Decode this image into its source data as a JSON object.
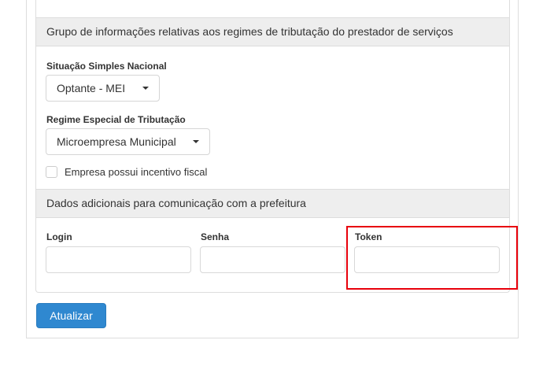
{
  "sections": {
    "tributacao": {
      "title": "Grupo de informações relativas aos regimes de tributação do prestador de serviços",
      "simples": {
        "label": "Situação Simples Nacional",
        "value": "Optante - MEI"
      },
      "regime": {
        "label": "Regime Especial de Tributação",
        "value": "Microempresa Municipal"
      },
      "incentivo": {
        "label": "Empresa possui incentivo fiscal",
        "checked": false
      }
    },
    "prefeitura": {
      "title": "Dados adicionais para comunicação com a prefeitura",
      "login": {
        "label": "Login",
        "value": ""
      },
      "senha": {
        "label": "Senha",
        "value": ""
      },
      "token": {
        "label": "Token",
        "value": ""
      }
    }
  },
  "actions": {
    "submit_label": "Atualizar"
  },
  "colors": {
    "primary": "#2f88d0",
    "highlight": "#e8000b",
    "section_bg": "#eeeeee"
  }
}
